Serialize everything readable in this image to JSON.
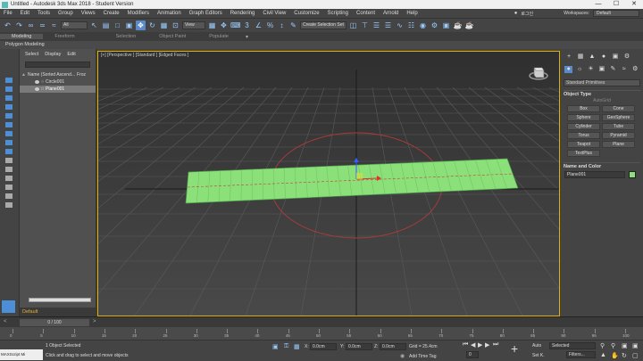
{
  "app": {
    "title": "Untitled - Autodesk 3ds Max 2018 - Student Version"
  },
  "window_buttons": [
    "—",
    "☐",
    "✕"
  ],
  "menu": [
    "File",
    "Edit",
    "Tools",
    "Group",
    "Views",
    "Create",
    "Modifiers",
    "Animation",
    "Graph Editors",
    "Rendering",
    "Civil View",
    "Customize",
    "Scripting",
    "Content",
    "Arnold",
    "Help"
  ],
  "signin": {
    "user": "로그인",
    "workspaces_label": "Workspaces:",
    "workspace": "Default"
  },
  "toolbar": {
    "filter": "All",
    "coord": "View",
    "selection_set": "Create Selection Set"
  },
  "ribbon": {
    "tabs": [
      "Modeling",
      "Freeform",
      "Selection",
      "Object Paint",
      "Populate"
    ],
    "subtitle": "Polygon Modeling"
  },
  "explorer": {
    "tabs": [
      "Select",
      "Display",
      "Edit"
    ],
    "col_name": "Name (Sorted Ascend...",
    "col_frozen": "Froz",
    "rows": [
      {
        "name": "Circle001"
      },
      {
        "name": "Plane001"
      }
    ],
    "layer": "Default"
  },
  "viewport": {
    "label": "[+] [Perspective ] [Standard ] [Edged Faces ]"
  },
  "command_panel": {
    "category": "Standard Primitives",
    "object_type": "Object Type",
    "autogrid": "AutoGrid",
    "buttons": [
      "Box",
      "Cone",
      "Sphere",
      "GeoSphere",
      "Cylinder",
      "Tube",
      "Torus",
      "Pyramid",
      "Teapot",
      "Plane",
      "TextPlus"
    ],
    "name_color": "Name and Color",
    "object_name": "Plane001",
    "object_color": "#8ce07a"
  },
  "timeline": {
    "position": "0 / 100",
    "ticks": [
      "0",
      "5",
      "10",
      "15",
      "20",
      "25",
      "30",
      "35",
      "40",
      "45",
      "50",
      "55",
      "60",
      "65",
      "70",
      "75",
      "80",
      "85",
      "90",
      "95",
      "100"
    ]
  },
  "status": {
    "maxscript": "MAXScript Mi",
    "selected": "1 Object Selected",
    "prompt": "Click and drag to select and move objects",
    "x": "0.0cm",
    "y": "0.0cm",
    "z": "0.0cm",
    "grid": "Grid = 25.4cm",
    "add_time_tag": "Add Time Tag",
    "auto": "Auto",
    "selected_dd": "Selected",
    "setk": "Set K.",
    "filters": "Filters..."
  },
  "colors": {
    "accent": "#5b8ac9",
    "active_viewport": "#e0b000",
    "plane": "#8ce07a",
    "circle": "#c04040"
  }
}
